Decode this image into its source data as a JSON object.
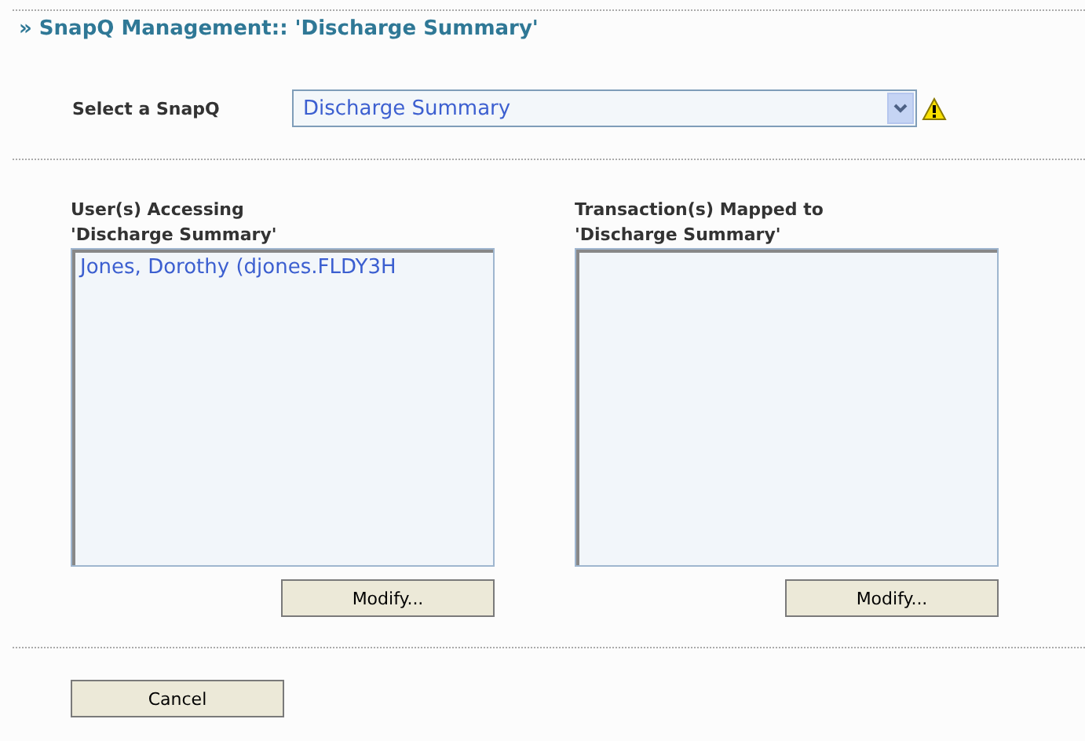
{
  "title": "» SnapQ Management:: 'Discharge Summary'",
  "snapq_select": {
    "label": "Select a SnapQ",
    "value": "Discharge Summary",
    "warning": true
  },
  "panels": [
    {
      "heading": [
        "User(s) Accessing",
        "'Discharge Summary'"
      ],
      "items": [
        {
          "text": "Jones, Dorothy (djones.FLDY3H",
          "selected": false
        }
      ],
      "button": "Modify..."
    },
    {
      "heading": [
        "Transaction(s) Mapped to",
        "'Discharge Summary'"
      ],
      "button": "Modify..."
    }
  ],
  "cancel_button": "Cancel"
}
